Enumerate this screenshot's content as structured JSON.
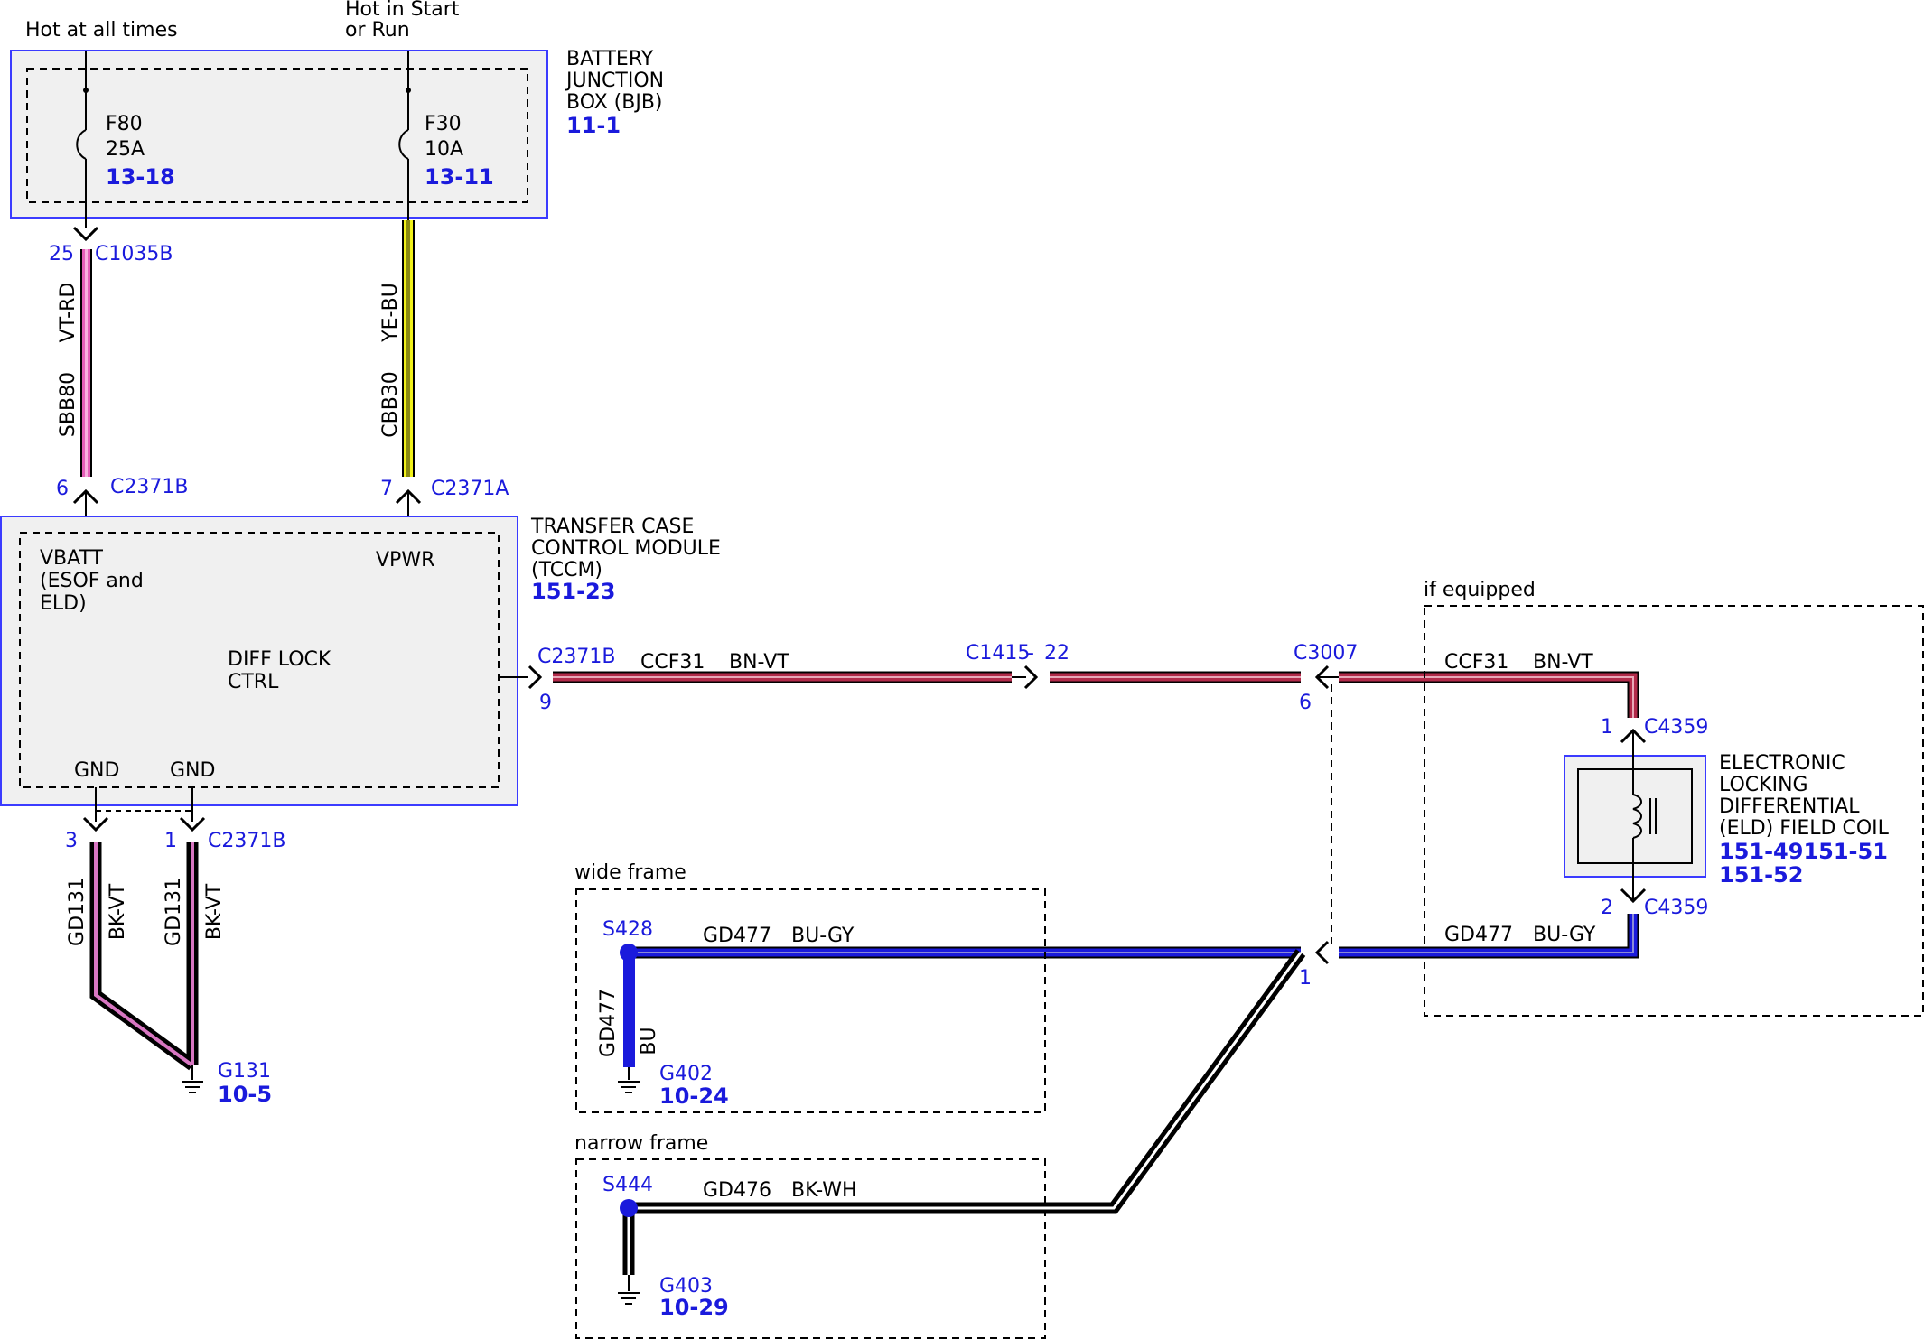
{
  "supplies": {
    "hot_always": "Hot at all times",
    "hot_start_run_1": "Hot in Start",
    "hot_start_run_2": "or Run"
  },
  "bjb": {
    "title_1": "BATTERY",
    "title_2": "JUNCTION",
    "title_3": "BOX (BJB)",
    "ref": "11-1",
    "fuse_a": {
      "name": "F80",
      "rating": "25A",
      "ref": "13-18"
    },
    "fuse_b": {
      "name": "F30",
      "rating": "10A",
      "ref": "13-11"
    }
  },
  "wires_top": {
    "left": {
      "pin_top": "25",
      "conn_top": "C1035B",
      "color": "VT-RD",
      "circuit": "SBB80",
      "pin_bottom": "6",
      "conn_bottom": "C2371B"
    },
    "right": {
      "color": "YE-BU",
      "circuit": "CBB30",
      "pin_bottom": "7",
      "conn_bottom": "C2371A"
    }
  },
  "tccm": {
    "title_1": "TRANSFER CASE",
    "title_2": "CONTROL MODULE",
    "title_3": "(TCCM)",
    "ref": "151-23",
    "vbatt_1": "VBATT",
    "vbatt_2": "(ESOF and",
    "vbatt_3": "ELD)",
    "vpwr": "VPWR",
    "diff_1": "DIFF LOCK",
    "diff_2": "CTRL",
    "gnd_1": "GND",
    "gnd_2": "GND"
  },
  "ground_wires": {
    "pin_left": "3",
    "pin_right": "1",
    "conn": "C2371B",
    "circuit": "GD131",
    "color": "BK-VT",
    "ground": "G131",
    "ground_ref": "10-5"
  },
  "ccf_line": {
    "conn_start": "C2371B",
    "pin_start": "9",
    "circuit": "CCF31",
    "color": "BN-VT",
    "inline_conn": "C1415",
    "inline_pin": "22",
    "conn_c3007": "C3007",
    "pin_c3007": "6"
  },
  "eld": {
    "if_equipped": "if equipped",
    "circuit": "CCF31",
    "color": "BN-VT",
    "pin_top": "1",
    "conn_top": "C4359",
    "title_1": "ELECTRONIC",
    "title_2": "LOCKING",
    "title_3": "DIFFERENTIAL",
    "title_4": "(ELD) FIELD COIL",
    "ref_1": "151-49151-51",
    "ref_2": "151-52",
    "pin_bottom": "2",
    "conn_bottom": "C4359",
    "gnd_circuit": "GD477",
    "gnd_color": "BU-GY"
  },
  "wide_frame": {
    "label": "wide frame",
    "splice": "S428",
    "circuit": "GD477",
    "color": "BU-GY",
    "vertical_circuit": "GD477",
    "vertical_color": "BU",
    "ground": "G402",
    "ground_ref": "10-24",
    "pin_c3007_low": "1"
  },
  "narrow_frame": {
    "label": "narrow frame",
    "splice": "S444",
    "circuit": "GD476",
    "color": "BK-WH",
    "ground": "G403",
    "ground_ref": "10-29"
  },
  "colors": {
    "box_border": "#3b3bff",
    "box_fill": "#f0f0f0",
    "label_blue": "#1a1adc",
    "wire_violet_red": "#e45fb8",
    "wire_yellow_blue": "#f2f21a",
    "wire_brown_violet": "#b22a4a",
    "wire_blue_gray": "#1a1adc",
    "wire_black_violet": "#111111"
  }
}
